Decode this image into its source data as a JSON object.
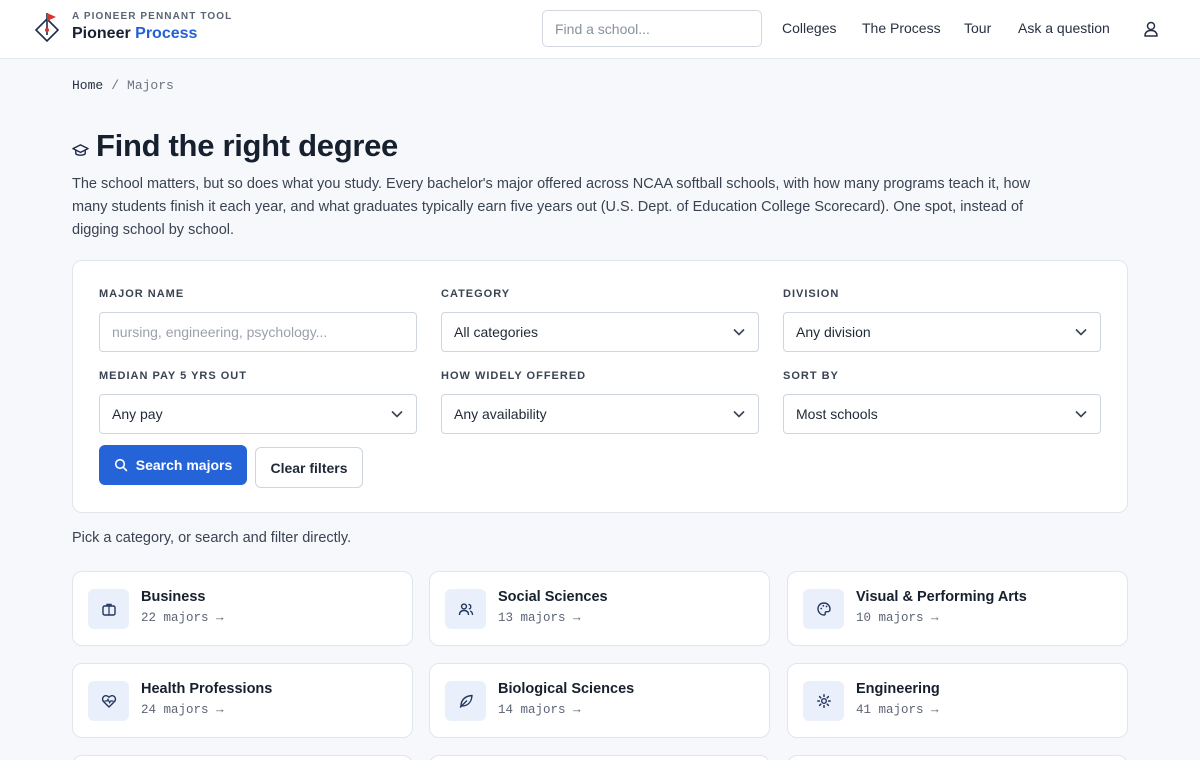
{
  "header": {
    "eyebrow": "A PIONEER PENNANT TOOL",
    "brand_main": "Pioneer",
    "brand_accent": "Process",
    "search_placeholder": "Find a school...",
    "nav": [
      "Colleges",
      "The Process",
      "Tour",
      "Ask a question"
    ],
    "user_icon": "user-icon"
  },
  "breadcrumb": {
    "home": "Home",
    "separator": "/",
    "current": "Majors"
  },
  "page": {
    "title": "Find the right degree",
    "title_icon": "graduation-cap-icon",
    "intro": "The school matters, but so does what you study. Every bachelor's major offered across NCAA softball schools, with how many programs teach it, how many students finish it each year, and what graduates typically earn five years out (U.S. Dept. of Education College Scorecard). One spot, instead of digging school by school."
  },
  "filters": {
    "major_name": {
      "label": "MAJOR NAME",
      "placeholder": "nursing, engineering, psychology..."
    },
    "category": {
      "label": "CATEGORY",
      "value": "All categories"
    },
    "division": {
      "label": "DIVISION",
      "value": "Any division"
    },
    "median_pay": {
      "label": "MEDIAN PAY 5 YRS OUT",
      "value": "Any pay"
    },
    "availability": {
      "label": "HOW WIDELY OFFERED",
      "value": "Any availability"
    },
    "sort": {
      "label": "SORT BY",
      "value": "Most schools"
    },
    "search_button": "Search majors",
    "clear_button": "Clear filters"
  },
  "pick_line": "Pick a category, or search and filter directly.",
  "categories": [
    {
      "name": "Business",
      "count": "22 majors →",
      "icon": "briefcase-icon"
    },
    {
      "name": "Social Sciences",
      "count": "13 majors →",
      "icon": "users-icon"
    },
    {
      "name": "Visual & Performing Arts",
      "count": "10 majors →",
      "icon": "palette-icon"
    },
    {
      "name": "Health Professions",
      "count": "24 majors →",
      "icon": "heart-pulse-icon"
    },
    {
      "name": "Biological Sciences",
      "count": "14 majors →",
      "icon": "leaf-icon"
    },
    {
      "name": "Engineering",
      "count": "41 majors →",
      "icon": "gear-icon"
    }
  ],
  "colors": {
    "accent": "#2563d9",
    "brand_red": "#d9352f"
  }
}
